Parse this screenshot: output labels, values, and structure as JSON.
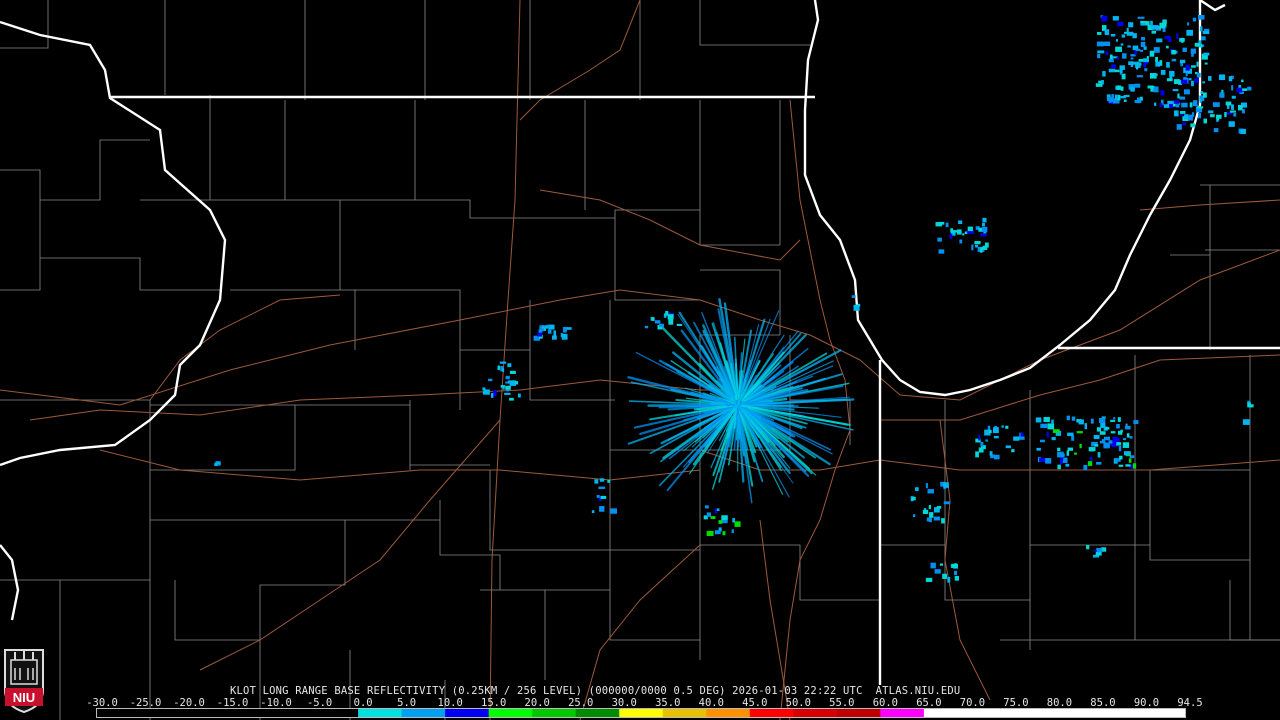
{
  "caption": "KLOT LONG RANGE BASE REFLECTIVITY (0.25KM / 256 LEVEL) (000000/0000 0.5 DEG) 2026-01-03 22:22 UTC  ATLAS.NIU.EDU",
  "logo": {
    "text": "NIU",
    "icon": "niu-logo-icon",
    "color": "#c8102e"
  },
  "colorbar": {
    "labels": [
      "-30.0",
      "-25.0",
      "-20.0",
      "-15.0",
      "-10.0",
      "-5.0",
      "0.0",
      "5.0",
      "10.0",
      "15.0",
      "20.0",
      "25.0",
      "30.0",
      "35.0",
      "40.0",
      "45.0",
      "50.0",
      "55.0",
      "60.0",
      "65.0",
      "70.0",
      "75.0",
      "80.0",
      "85.0",
      "90.0",
      "94.5"
    ],
    "colors": [
      "#000000",
      "#000000",
      "#000000",
      "#000000",
      "#000000",
      "#000000",
      "#00e0e0",
      "#00a0f0",
      "#0000f0",
      "#00ff00",
      "#00c800",
      "#008c00",
      "#ffff00",
      "#e7c000",
      "#ff9000",
      "#ff0000",
      "#d60000",
      "#c00000",
      "#ff00ff",
      "#9955c9",
      "#ffffff",
      "#ffffff",
      "#ffffff",
      "#ffffff",
      "#ffffff",
      "#ffffff"
    ]
  },
  "map_colors": {
    "state_border": "#ffffff",
    "county_border": "#8c8c8c",
    "highway": "#9c5a3c"
  }
}
